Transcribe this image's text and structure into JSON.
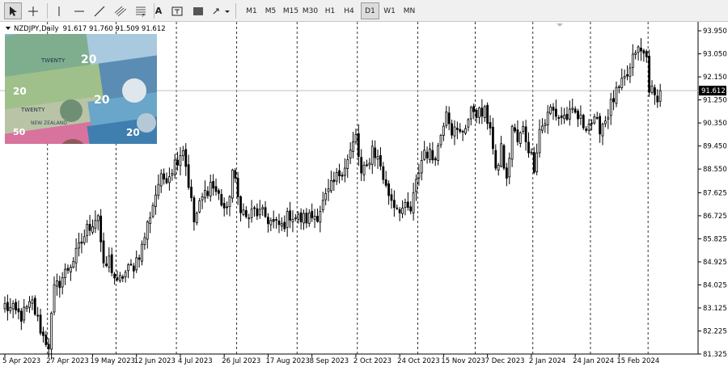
{
  "toolbar": {
    "tools": [
      {
        "name": "cursor-tool",
        "icon": "cursor-arrow-icon"
      },
      {
        "name": "crosshair-tool",
        "icon": "crosshair-icon"
      },
      {
        "name": "vertical-line-tool",
        "icon": "vertical-line-icon"
      },
      {
        "name": "horizontal-line-tool",
        "icon": "horizontal-line-icon"
      },
      {
        "name": "trendline-tool",
        "icon": "trendline-icon"
      },
      {
        "name": "channel-tool",
        "icon": "equidistant-channel-icon"
      },
      {
        "name": "fibonacci-tool",
        "icon": "fibonacci-icon"
      },
      {
        "name": "text-tool",
        "icon": "text-a-icon",
        "label": "A"
      },
      {
        "name": "text-label-tool",
        "icon": "text-label-icon",
        "label": "T"
      },
      {
        "name": "rectangle-tool",
        "icon": "rectangle-icon"
      },
      {
        "name": "arrows-tool",
        "icon": "arrows-dropdown-icon"
      }
    ],
    "timeframes": [
      "M1",
      "M5",
      "M15",
      "M30",
      "H1",
      "H4",
      "D1",
      "W1",
      "MN"
    ],
    "active_timeframe": "D1"
  },
  "chart_data": {
    "type": "candlestick",
    "symbol_label": "NZDJPY,Daily",
    "ohlc_label": "91.617 91.760 91.509 91.612",
    "ylim": [
      81.325,
      94.3
    ],
    "yticks": [
      "93.950",
      "93.050",
      "92.150",
      "91.250",
      "90.350",
      "89.450",
      "88.550",
      "87.625",
      "86.725",
      "85.825",
      "84.925",
      "84.025",
      "83.125",
      "82.225",
      "81.325"
    ],
    "current_price": "91.612",
    "x_labels": [
      "5 Apr 2023",
      "27 Apr 2023",
      "19 May 2023",
      "12 Jun 2023",
      "4 Jul 2023",
      "26 Jul 2023",
      "17 Aug 2023",
      "8 Sep 2023",
      "2 Oct 2023",
      "24 Oct 2023",
      "15 Nov 2023",
      "7 Dec 2023",
      "2 Jan 2024",
      "24 Jan 2024",
      "15 Feb 2024"
    ],
    "label_bar_index": [
      0,
      16,
      32,
      48,
      64,
      80,
      96,
      112,
      128,
      144,
      160,
      176,
      192,
      208,
      224
    ],
    "period_separators_at_bar": [
      16,
      41,
      63,
      85,
      107,
      129,
      151,
      172,
      193,
      214,
      235
    ],
    "close_path": [
      [
        0,
        83.2
      ],
      [
        6,
        82.8
      ],
      [
        10,
        83.3
      ],
      [
        14,
        82.0
      ],
      [
        16,
        81.7
      ],
      [
        18,
        83.8
      ],
      [
        22,
        84.5
      ],
      [
        26,
        85.2
      ],
      [
        30,
        86.2
      ],
      [
        34,
        86.8
      ],
      [
        36,
        84.6
      ],
      [
        38,
        85.0
      ],
      [
        41,
        84.0
      ],
      [
        43,
        84.4
      ],
      [
        47,
        84.8
      ],
      [
        50,
        85.5
      ],
      [
        53,
        86.8
      ],
      [
        56,
        88.0
      ],
      [
        60,
        88.4
      ],
      [
        62,
        88.8
      ],
      [
        65,
        89.4
      ],
      [
        67,
        88.0
      ],
      [
        69,
        86.5
      ],
      [
        72,
        87.4
      ],
      [
        75,
        88.0
      ],
      [
        78,
        87.5
      ],
      [
        81,
        86.8
      ],
      [
        83,
        88.5
      ],
      [
        85,
        87.4
      ],
      [
        88,
        86.6
      ],
      [
        91,
        86.9
      ],
      [
        95,
        86.7
      ],
      [
        98,
        86.4
      ],
      [
        101,
        86.3
      ],
      [
        104,
        86.8
      ],
      [
        107,
        86.6
      ],
      [
        110,
        86.6
      ],
      [
        114,
        86.8
      ],
      [
        118,
        87.6
      ],
      [
        122,
        88.4
      ],
      [
        125,
        88.9
      ],
      [
        128,
        89.8
      ],
      [
        130,
        88.3
      ],
      [
        132,
        88.6
      ],
      [
        134,
        89.4
      ],
      [
        137,
        88.7
      ],
      [
        139,
        87.8
      ],
      [
        142,
        87.2
      ],
      [
        145,
        87.0
      ],
      [
        148,
        86.9
      ],
      [
        151,
        88.5
      ],
      [
        153,
        89.3
      ],
      [
        156,
        89.0
      ],
      [
        158,
        89.4
      ],
      [
        161,
        91.0
      ],
      [
        163,
        90.1
      ],
      [
        166,
        89.9
      ],
      [
        169,
        90.5
      ],
      [
        171,
        90.9
      ],
      [
        173,
        90.7
      ],
      [
        175,
        90.7
      ],
      [
        177,
        90.3
      ],
      [
        179,
        88.3
      ],
      [
        181,
        89.4
      ],
      [
        183,
        88.0
      ],
      [
        185,
        90.2
      ],
      [
        187,
        89.6
      ],
      [
        189,
        90.1
      ],
      [
        191,
        89.4
      ],
      [
        193,
        88.7
      ],
      [
        195,
        90.1
      ],
      [
        197,
        90.4
      ],
      [
        199,
        90.9
      ],
      [
        202,
        90.6
      ],
      [
        205,
        90.6
      ],
      [
        208,
        90.7
      ],
      [
        211,
        90.3
      ],
      [
        214,
        90.4
      ],
      [
        217,
        90.2
      ],
      [
        219,
        90.5
      ],
      [
        222,
        91.3
      ],
      [
        225,
        91.8
      ],
      [
        228,
        92.4
      ],
      [
        230,
        93.2
      ],
      [
        232,
        93.1
      ],
      [
        234,
        92.9
      ],
      [
        235,
        91.8
      ],
      [
        237,
        91.3
      ],
      [
        239,
        91.612
      ]
    ],
    "bar_count": 240,
    "grid": false,
    "price_line_color": "#c0c0c0",
    "candle_color": "#000000"
  }
}
